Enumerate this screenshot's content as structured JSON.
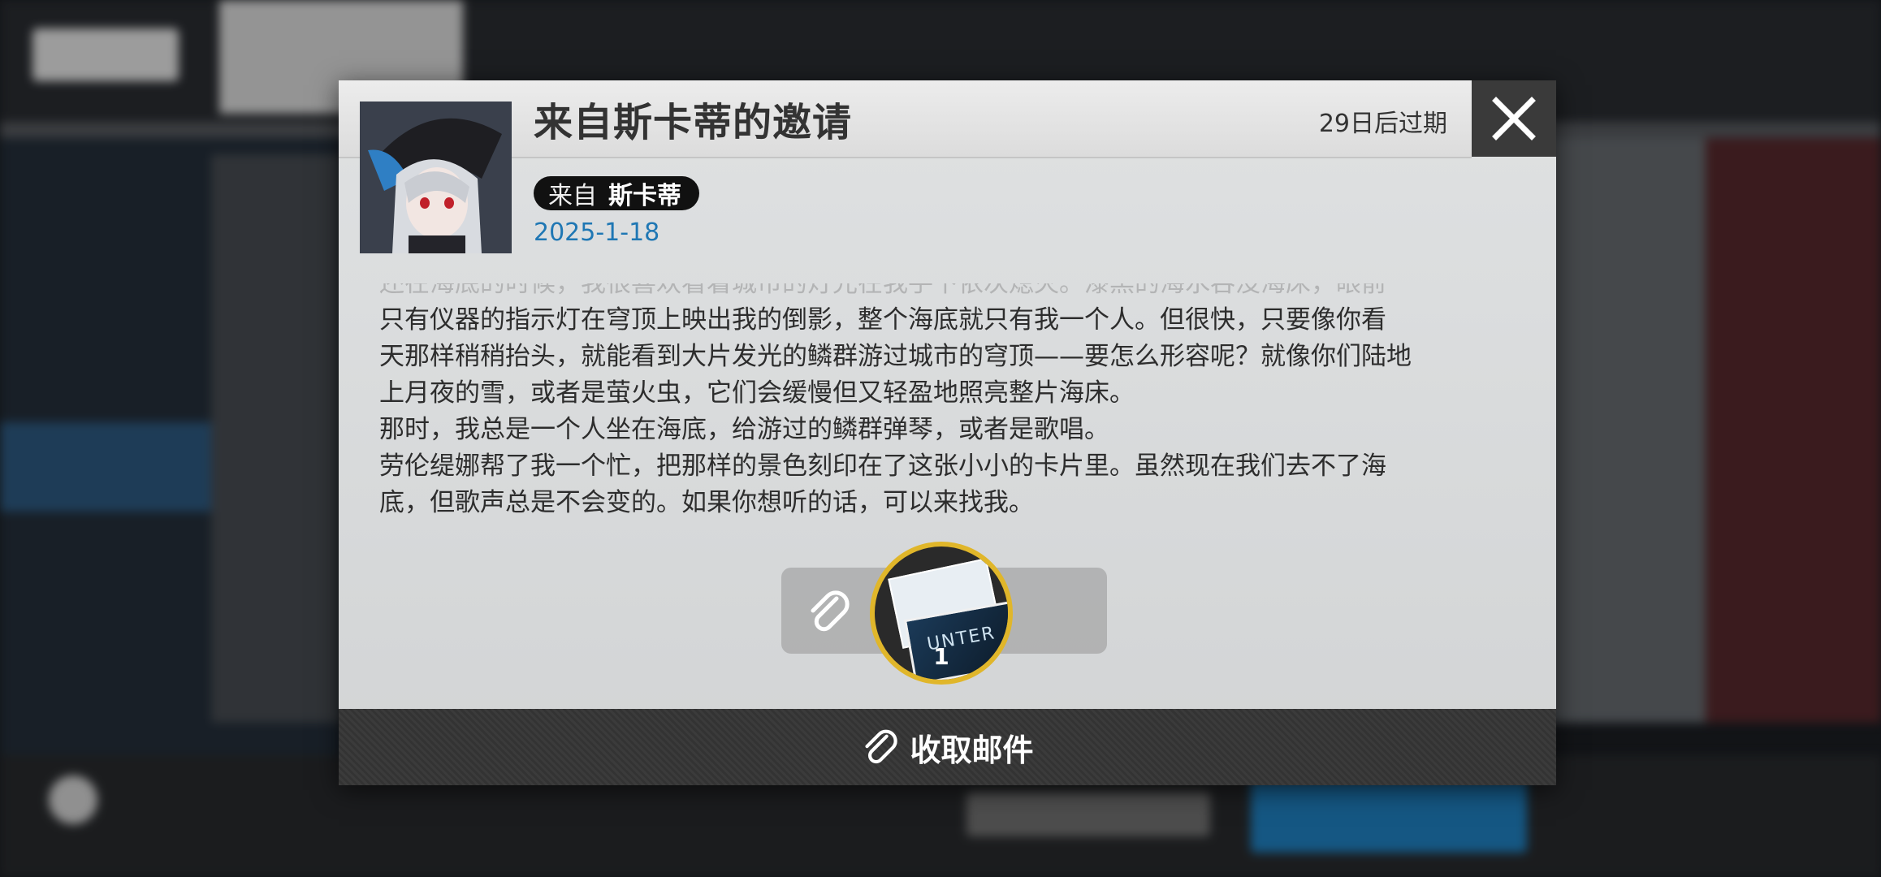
{
  "mail": {
    "title": "来自斯卡蒂的邀请",
    "expiry": "29日后过期",
    "from_label": "来自",
    "sender_name": "斯卡蒂",
    "date": "2025-1-18",
    "body_faded": "还在海底的时候，我很喜欢看着城市的灯光在我手下依次熄灭。漆黑的海水吞没海床，眼前",
    "body_lines": [
      "只有仪器的指示灯在穹顶上映出我的倒影，整个海底就只有我一个人。但很快，只要像你看",
      "天那样稍稍抬头，就能看到大片发光的鳞群游过城市的穹顶——要怎么形容呢？就像你们陆地",
      "上月夜的雪，或者是萤火虫，它们会缓慢但又轻盈地照亮整片海床。",
      "那时，我总是一个人坐在海底，给游过的鳞群弹琴，或者是歌唱。",
      "劳伦缇娜帮了我一个忙，把那样的景色刻印在了这张小小的卡片里。虽然现在我们去不了海",
      "底，但歌声总是不会变的。如果你想听的话，可以来找我。"
    ],
    "attachment": {
      "card_text": "UNTER",
      "count": "1"
    },
    "collect_label": "收取邮件"
  },
  "icons": {
    "close": "close-icon",
    "attach": "paperclip-icon"
  },
  "colors": {
    "date": "#1f77b4",
    "attachment_ring": "#e0b62a"
  }
}
